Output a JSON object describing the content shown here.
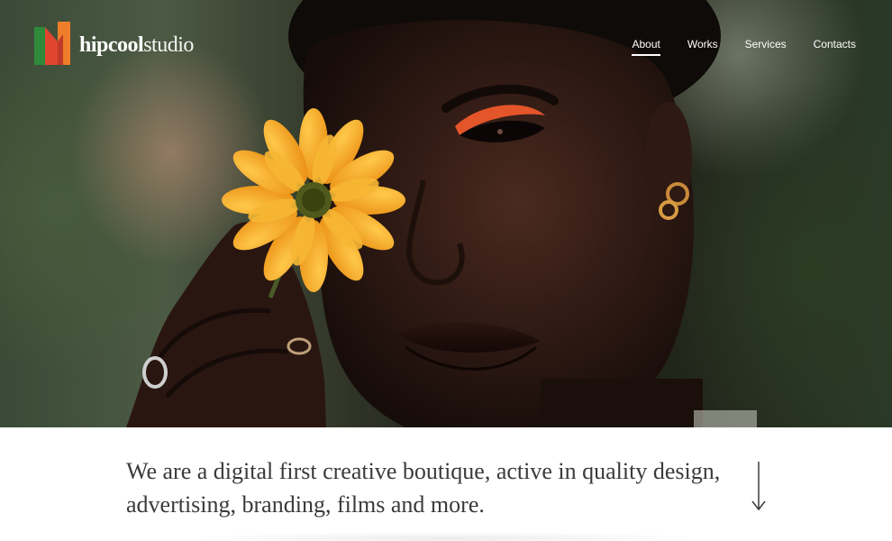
{
  "brand": {
    "name_bold": "hipcool",
    "name_light": "studio",
    "logo_colors": {
      "green": "#2f8a3a",
      "red": "#e0462f",
      "orange": "#f07d2a"
    }
  },
  "nav": {
    "items": [
      {
        "label": "About",
        "active": true
      },
      {
        "label": "Works",
        "active": false
      },
      {
        "label": "Services",
        "active": false
      },
      {
        "label": "Contacts",
        "active": false
      }
    ]
  },
  "hero": {
    "image_subject": "portrait-with-yellow-flower"
  },
  "intro": {
    "line1": "We are a digital first creative boutique, active in quality design,",
    "line2": "advertising, branding, films and more."
  },
  "icons": {
    "scroll": "arrow-down-icon"
  },
  "colors": {
    "nav_text": "#ffffff",
    "body_text": "#3a3a3a",
    "flower": "#f5a623"
  }
}
